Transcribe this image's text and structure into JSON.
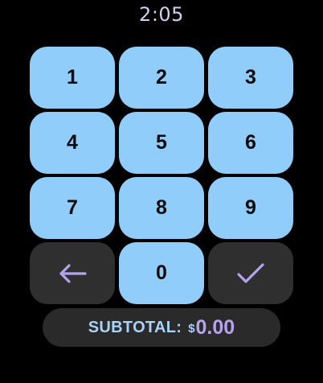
{
  "status": {
    "time": "2:05"
  },
  "keypad": {
    "keys": [
      "1",
      "2",
      "3",
      "4",
      "5",
      "6",
      "7",
      "8",
      "9",
      "0"
    ],
    "backspace_icon": "arrow-left-icon",
    "confirm_icon": "check-icon"
  },
  "subtotal": {
    "label": "SUBTOTAL:",
    "currency": "$",
    "amount": "0.00"
  },
  "colors": {
    "background": "#000000",
    "key": "#90cdfa",
    "dark_key": "#2f2f2f",
    "accent": "#b6a3ee",
    "subtotal_text": "#a9d2f7"
  }
}
